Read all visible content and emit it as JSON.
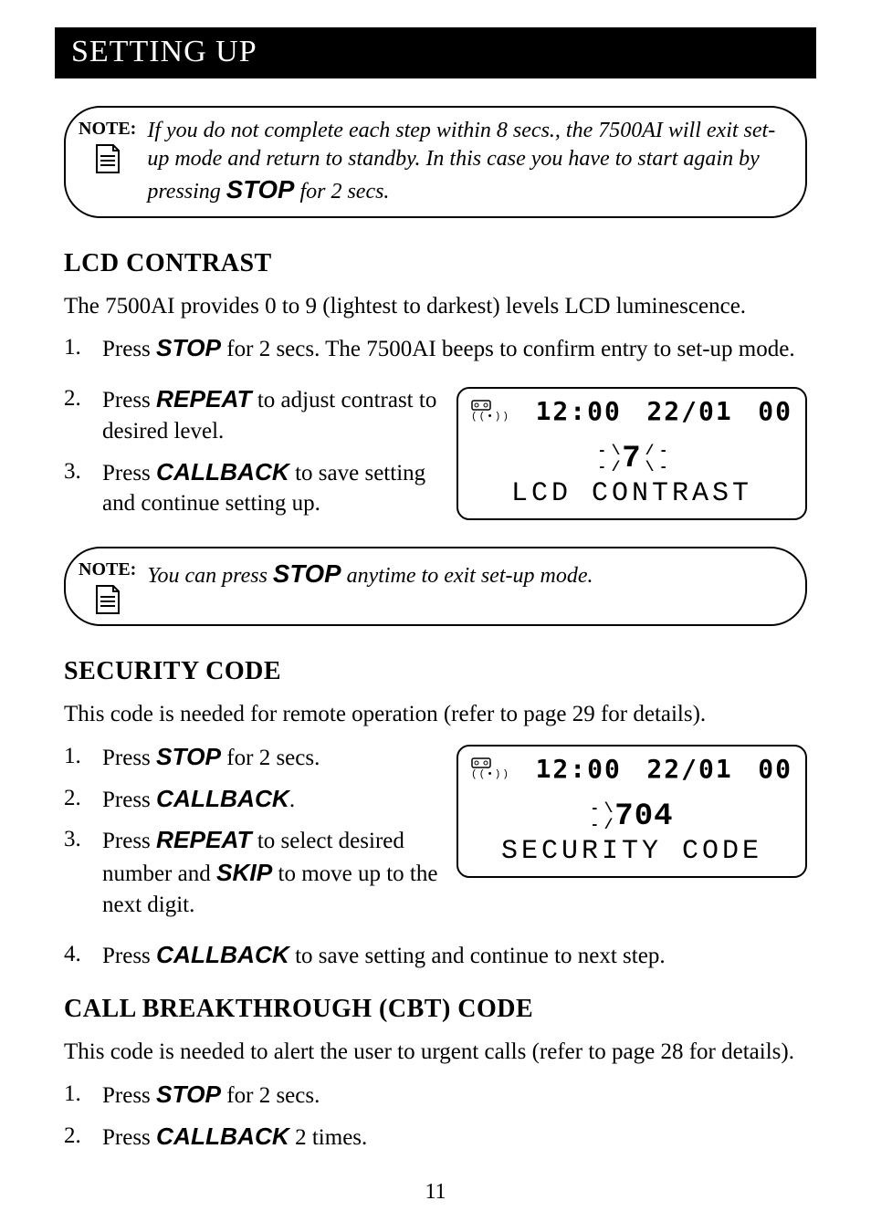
{
  "header": "SETTING UP",
  "note1": {
    "label": "NOTE:",
    "text_a": "If you do not complete each step within 8 secs., the 7500AI will exit set-up mode and return to standby. In this case you have to start again by pressing ",
    "btn": "STOP",
    "text_b": " for 2 secs."
  },
  "sec1": {
    "title": "LCD CONTRAST",
    "intro": "The 7500AI provides 0 to 9 (lightest to darkest) levels LCD luminescence.",
    "steps": [
      {
        "num": "1.",
        "pre": "Press ",
        "btn": "STOP",
        "post": " for 2 secs. The 7500AI beeps to confirm entry to set-up mode."
      },
      {
        "num": "2.",
        "pre": "Press ",
        "btn": "REPEAT",
        "post": " to adjust contrast to desired level."
      },
      {
        "num": "3.",
        "pre": "Press ",
        "btn": "CALLBACK",
        "post": " to save setting and continue setting up."
      }
    ],
    "lcd": {
      "time": "12:00",
      "date": "22/01",
      "count": "00",
      "mid": "7",
      "label": "LCD CONTRAST"
    }
  },
  "note2": {
    "label": "NOTE:",
    "text_a": "You can press ",
    "btn": "STOP",
    "text_b": " anytime to exit set-up mode."
  },
  "sec2": {
    "title": "SECURITY CODE",
    "intro": "This code is needed for remote operation (refer to page 29 for details).",
    "steps": [
      {
        "num": "1.",
        "pre": "Press ",
        "btn": "STOP",
        "post": " for 2 secs."
      },
      {
        "num": "2.",
        "pre": "Press ",
        "btn": "CALLBACK",
        "post": "."
      },
      {
        "num": "3.",
        "pre": "Press ",
        "btn": "REPEAT",
        "mid": " to select desired number and ",
        "btn2": "SKIP",
        "post": " to move up to the next digit."
      },
      {
        "num": "4.",
        "pre": "Press ",
        "btn": "CALLBACK",
        "post": " to save setting and continue to next step."
      }
    ],
    "lcd": {
      "time": "12:00",
      "date": "22/01",
      "count": "00",
      "mid": "704",
      "label": "SECURITY CODE"
    }
  },
  "sec3": {
    "title": "CALL BREAKTHROUGH (CBT) CODE",
    "intro": "This code is needed to alert the user to urgent calls (refer to page 28 for details).",
    "steps": [
      {
        "num": "1.",
        "pre": "Press ",
        "btn": "STOP",
        "post": " for 2 secs."
      },
      {
        "num": "2.",
        "pre": "Press ",
        "btn": "CALLBACK",
        "post": " 2 times."
      }
    ]
  },
  "pagenum": "11"
}
